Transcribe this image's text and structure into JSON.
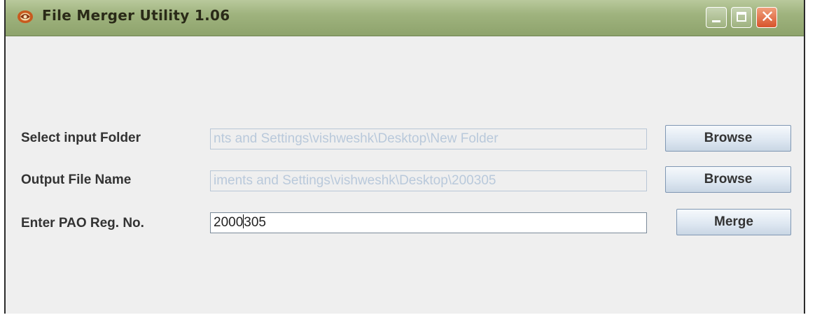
{
  "window": {
    "title": "File Merger Utility 1.06",
    "controls": {
      "minimize_icon": "minimize-icon",
      "maximize_icon": "maximize-icon",
      "close_icon": "close-icon",
      "close_glyph": "✕"
    }
  },
  "form": {
    "input_folder": {
      "label": "Select input Folder",
      "value": "nts and Settings\\vishweshk\\Desktop\\New Folder",
      "button": "Browse"
    },
    "output_file": {
      "label": "Output File Name",
      "value": "iments and Settings\\vishweshk\\Desktop\\200305",
      "button": "Browse"
    },
    "pao_reg": {
      "label": "Enter PAO Reg. No.",
      "value_before_caret": "2000",
      "value_after_caret": "305",
      "button": "Merge"
    }
  },
  "colors": {
    "titlebar": "#9fb37e",
    "background": "#efefef",
    "disabled_text": "#b9c9db",
    "close_button": "#d8532c"
  }
}
